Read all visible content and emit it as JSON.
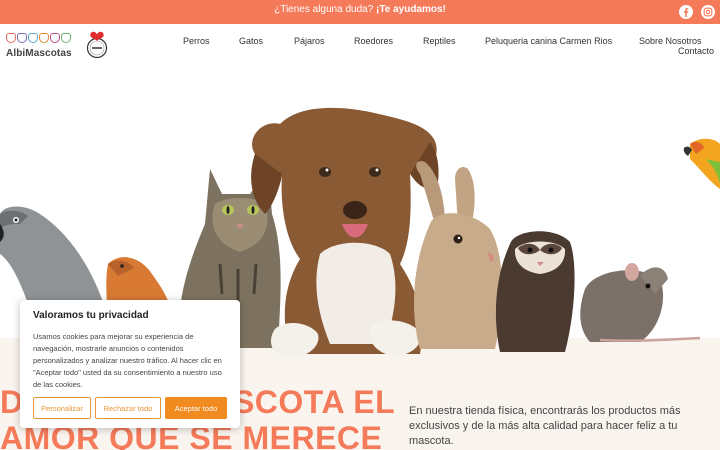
{
  "topbar": {
    "promo_text": "¿Tienes alguna duda? ",
    "promo_link": "¡Te ayudamos!",
    "social": [
      {
        "icon": "facebook-icon"
      },
      {
        "icon": "instagram-icon"
      }
    ]
  },
  "header": {
    "logo_text": "AlbiMascotas",
    "nav": [
      {
        "label": "Perros"
      },
      {
        "label": "Gatos"
      },
      {
        "label": "Pájaros"
      },
      {
        "label": "Roedores"
      },
      {
        "label": "Reptiles"
      },
      {
        "label": "Peluqueria canina Carmen Rios"
      },
      {
        "label": "Sobre Nosotros"
      },
      {
        "label": "Contacto"
      }
    ]
  },
  "hero": {
    "headline_line1": "DALE A TU MASCOTA EL",
    "headline_line2": "AMOR QUE SE MERECE",
    "subtext": "En nuestra tienda física, encontrarás los productos más exclusivos y de la más alta calidad para hacer feliz a tu mascota."
  },
  "cookie_banner": {
    "title": "Valoramos tu privacidad",
    "body": "Usamos cookies para mejorar su experiencia de navegación, mostrarle anuncios o contenidos personalizados y analizar nuestro tráfico. Al hacer clic en \"Aceptar todo\" usted da su consentimiento a nuestro uso de las cookies.",
    "customize_label": "Personalizar",
    "reject_label": "Rechazar todo",
    "accept_label": "Aceptar todo"
  },
  "colors": {
    "brand": "#f47a5a",
    "button_accent": "#f18a1f"
  }
}
